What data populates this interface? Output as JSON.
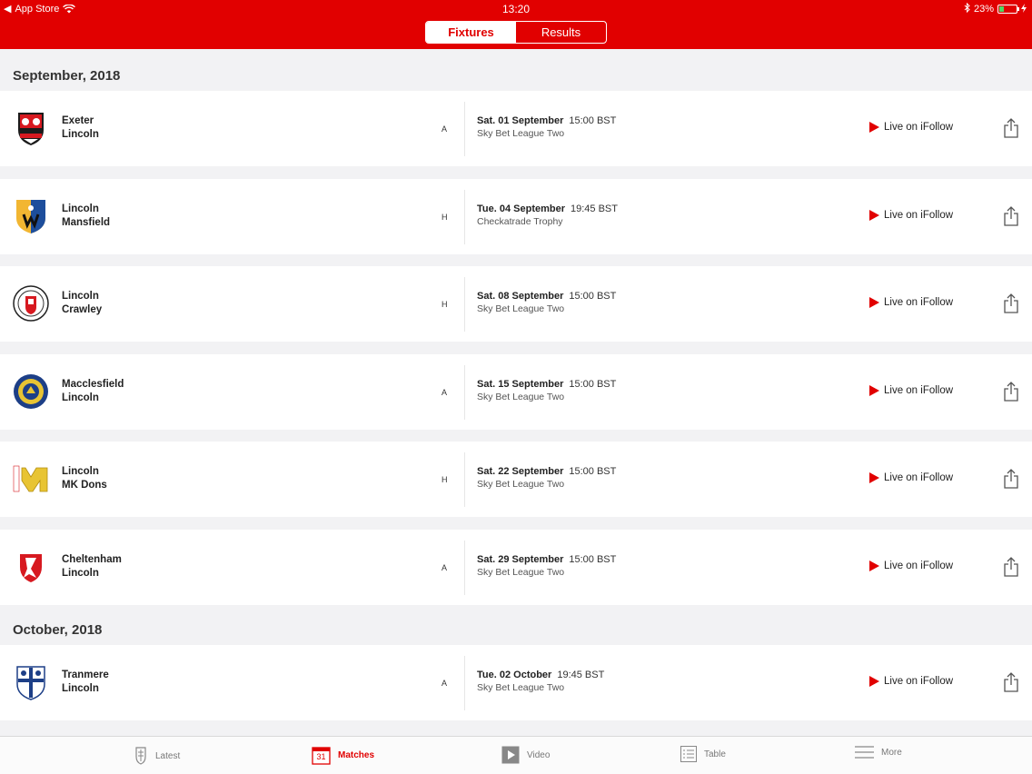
{
  "status_bar": {
    "back_app": "App Store",
    "time": "13:20",
    "battery": "23%"
  },
  "segmented": {
    "fixtures": "Fixtures",
    "results": "Results"
  },
  "sections": [
    {
      "title": "September, 2018",
      "fixtures": [
        {
          "home": "Exeter",
          "away": "Lincoln",
          "venue": "A",
          "date": "Sat. 01 September",
          "time": "15:00 BST",
          "competition": "Sky Bet League Two",
          "live": "Live on iFollow",
          "crest_icon": "exeter-crest-icon"
        },
        {
          "home": "Lincoln",
          "away": "Mansfield",
          "venue": "H",
          "date": "Tue. 04 September",
          "time": "19:45 BST",
          "competition": "Checkatrade Trophy",
          "live": "Live on iFollow",
          "crest_icon": "mansfield-crest-icon"
        },
        {
          "home": "Lincoln",
          "away": "Crawley",
          "venue": "H",
          "date": "Sat. 08 September",
          "time": "15:00 BST",
          "competition": "Sky Bet League Two",
          "live": "Live on iFollow",
          "crest_icon": "crawley-crest-icon"
        },
        {
          "home": "Macclesfield",
          "away": "Lincoln",
          "venue": "A",
          "date": "Sat. 15 September",
          "time": "15:00 BST",
          "competition": "Sky Bet League Two",
          "live": "Live on iFollow",
          "crest_icon": "macclesfield-crest-icon"
        },
        {
          "home": "Lincoln",
          "away": "MK Dons",
          "venue": "H",
          "date": "Sat. 22 September",
          "time": "15:00 BST",
          "competition": "Sky Bet League Two",
          "live": "Live on iFollow",
          "crest_icon": "mkdons-crest-icon"
        },
        {
          "home": "Cheltenham",
          "away": "Lincoln",
          "venue": "A",
          "date": "Sat. 29 September",
          "time": "15:00 BST",
          "competition": "Sky Bet League Two",
          "live": "Live on iFollow",
          "crest_icon": "cheltenham-crest-icon"
        }
      ]
    },
    {
      "title": "October, 2018",
      "fixtures": [
        {
          "home": "Tranmere",
          "away": "Lincoln",
          "venue": "A",
          "date": "Tue. 02 October",
          "time": "19:45 BST",
          "competition": "Sky Bet League Two",
          "live": "Live on iFollow",
          "crest_icon": "tranmere-crest-icon"
        }
      ]
    }
  ],
  "tabbar": {
    "latest": "Latest",
    "matches": "Matches",
    "matches_icon_day": "31",
    "video": "Video",
    "table": "Table",
    "more": "More"
  },
  "colors": {
    "brand_red": "#e10000",
    "background": "#f2f2f4"
  }
}
